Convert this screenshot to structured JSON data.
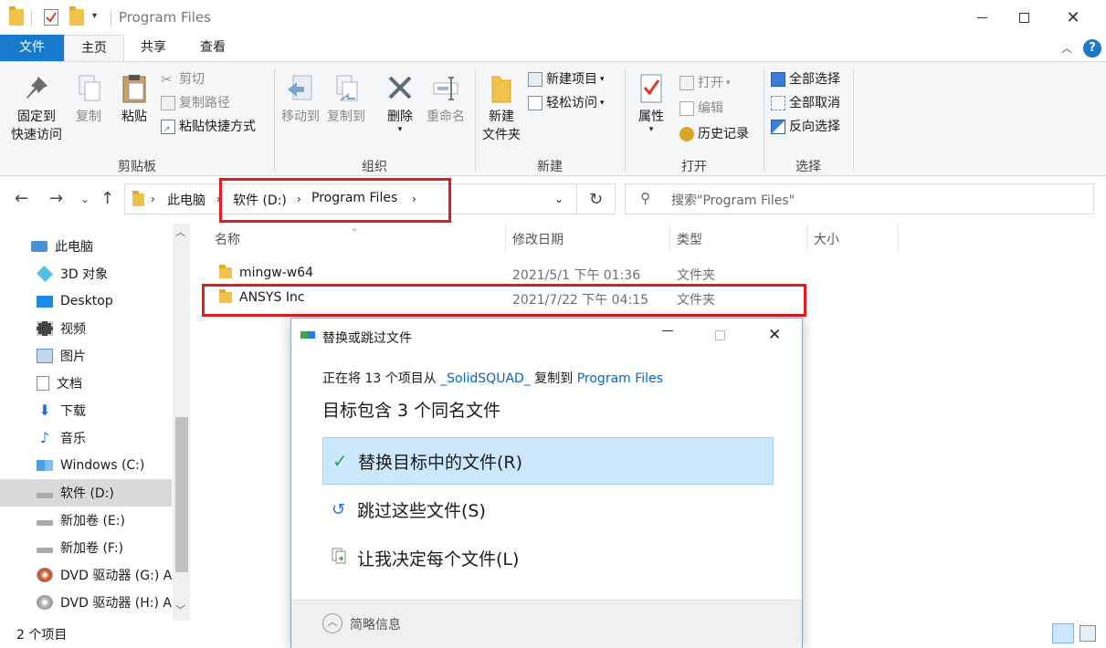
{
  "window": {
    "title": "Program Files"
  },
  "ribbon_tabs": [
    "文件",
    "主页",
    "共享",
    "查看"
  ],
  "ribbon": {
    "clipboard": {
      "pin_label_1": "固定到",
      "pin_label_2": "快速访问",
      "copy": "复制",
      "paste": "粘贴",
      "cut": "剪切",
      "copy_path": "复制路径",
      "paste_shortcut": "粘贴快捷方式",
      "group": "剪贴板"
    },
    "organize": {
      "move_to": "移动到",
      "copy_to": "复制到",
      "delete": "删除",
      "rename": "重命名",
      "group": "组织"
    },
    "new": {
      "new_folder_1": "新建",
      "new_folder_2": "文件夹",
      "new_item": "新建项目",
      "easy_access": "轻松访问",
      "group": "新建"
    },
    "open": {
      "properties": "属性",
      "open": "打开",
      "edit": "编辑",
      "history": "历史记录",
      "group": "打开"
    },
    "select": {
      "select_all": "全部选择",
      "select_none": "全部取消",
      "invert": "反向选择",
      "group": "选择"
    }
  },
  "address": {
    "crumbs": [
      "此电脑",
      "软件 (D:)",
      "Program Files"
    ],
    "search_placeholder": "搜索\"Program Files\""
  },
  "nav_pane": [
    "此电脑",
    "3D 对象",
    "Desktop",
    "视频",
    "图片",
    "文档",
    "下载",
    "音乐",
    "Windows (C:)",
    "软件 (D:)",
    "新加卷 (E:)",
    "新加卷 (F:)",
    "DVD 驱动器 (G:) A",
    "DVD 驱动器 (H:) A"
  ],
  "columns": {
    "name": "名称",
    "date": "修改日期",
    "type": "类型",
    "size": "大小"
  },
  "files": [
    {
      "name": "mingw-w64",
      "date": "2021/5/1 下午 01:36",
      "type": "文件夹"
    },
    {
      "name": "ANSYS Inc",
      "date": "2021/7/22 下午 04:15",
      "type": "文件夹"
    }
  ],
  "status": {
    "count": "2 个项目"
  },
  "dialog": {
    "title": "替换或跳过文件",
    "line_prefix": "正在将 13 个项目从 ",
    "source": "_SolidSQUAD_",
    "line_mid": " 复制到 ",
    "dest": "Program Files",
    "heading": "目标包含 3 个同名文件",
    "options": [
      "替换目标中的文件(R)",
      "跳过这些文件(S)",
      "让我决定每个文件(L)"
    ],
    "details": "简略信息"
  },
  "colors": {
    "accent": "#1979ca",
    "highlight_box": "#e21c1c",
    "selection": "#cce8ff",
    "folder": "#f1c24a"
  }
}
